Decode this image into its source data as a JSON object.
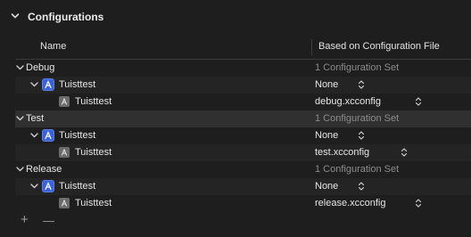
{
  "section": {
    "title": "Configurations"
  },
  "columns": {
    "name": "Name",
    "based_on": "Based on Configuration File"
  },
  "configurations": [
    {
      "name": "Debug",
      "summary": "1 Configuration Set",
      "project": {
        "name": "Tuisttest",
        "value": "None"
      },
      "target": {
        "name": "Tuisttest",
        "value": "debug.xcconfig"
      }
    },
    {
      "name": "Test",
      "summary": "1 Configuration Set",
      "project": {
        "name": "Tuisttest",
        "value": "None"
      },
      "target": {
        "name": "Tuisttest",
        "value": "test.xcconfig"
      }
    },
    {
      "name": "Release",
      "summary": "1 Configuration Set",
      "project": {
        "name": "Tuisttest",
        "value": "None"
      },
      "target": {
        "name": "Tuisttest",
        "value": "release.xcconfig"
      }
    }
  ],
  "footer": {
    "add_label": "+",
    "remove_label": "—"
  },
  "colors": {
    "background": "#1e1e1e",
    "selected_row": "#303030",
    "target_icon": "#3b63d8",
    "muted_text": "#8c8c8c"
  }
}
